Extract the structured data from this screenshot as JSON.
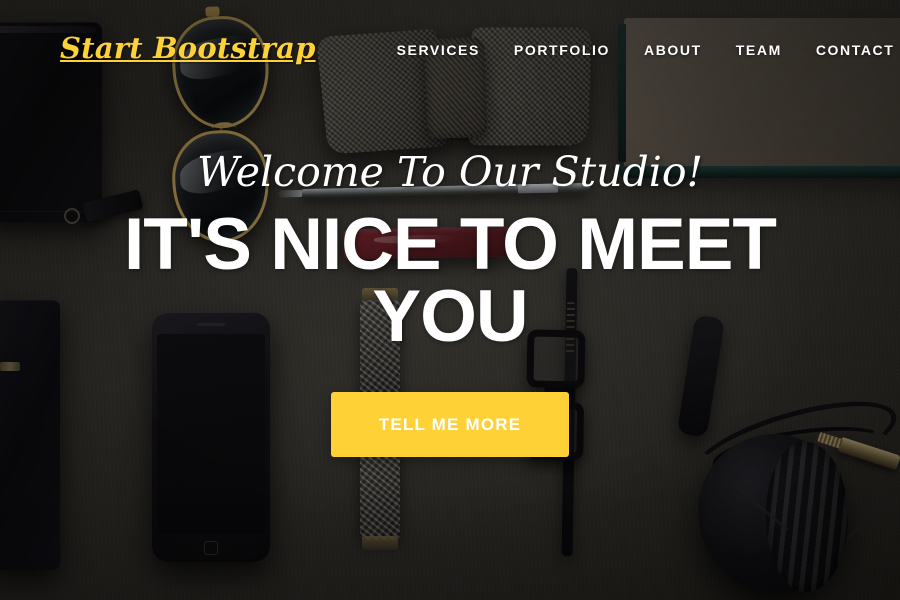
{
  "navbar": {
    "brand": "Start Bootstrap",
    "brand_color": "#fed136",
    "links": [
      {
        "label": "Services",
        "display": "SERVICES"
      },
      {
        "label": "Portfolio",
        "display": "PORTFOLIO"
      },
      {
        "label": "About",
        "display": "ABOUT"
      },
      {
        "label": "Team",
        "display": "TEAM"
      },
      {
        "label": "Contact",
        "display": "CONTACT"
      }
    ]
  },
  "hero": {
    "lead": "Welcome To Our Studio!",
    "heading": "IT'S NICE TO MEET YOU",
    "cta_label": "TELL ME MORE",
    "cta_background": "#fed136",
    "cta_text_color": "#ffffff",
    "text_color": "#ffffff",
    "background_description": "dark desk flat-lay photo with wallet, sunglasses, bow tie, pen, phone, watch, eyeglasses, notebook and headphones",
    "overlay_color": "rgba(0,0,0,0.30)"
  }
}
